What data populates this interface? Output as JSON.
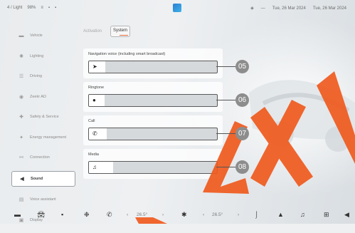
{
  "status_bar": {
    "left_items": [
      "4 / Light",
      "98%",
      "≡",
      "▪",
      "▪"
    ],
    "right_items": [
      "◈",
      "—",
      "Tue, 26 Mar 2024",
      "Tue, 26 Mar 2024"
    ]
  },
  "sidebar": {
    "items": [
      {
        "icon": "vehicle-icon",
        "glyph": "▬",
        "label": "Vehicle"
      },
      {
        "icon": "lighting-icon",
        "glyph": "✺",
        "label": "Lighting"
      },
      {
        "icon": "driving-icon",
        "glyph": "☰",
        "label": "Driving"
      },
      {
        "icon": "zeekr-ad-icon",
        "glyph": "◉",
        "label": "Zeekr AD"
      },
      {
        "icon": "safety-icon",
        "glyph": "✚",
        "label": "Safety & Service"
      },
      {
        "icon": "energy-icon",
        "glyph": "✦",
        "label": "Energy management"
      },
      {
        "icon": "connection-icon",
        "glyph": "⚯",
        "label": "Connection"
      },
      {
        "icon": "sound-icon",
        "glyph": "◀",
        "label": "Sound"
      },
      {
        "icon": "voice-assistant-icon",
        "glyph": "▤",
        "label": "Voice assistant"
      },
      {
        "icon": "display-icon",
        "glyph": "▣",
        "label": "Display"
      }
    ]
  },
  "tabs": [
    {
      "label": "Activation",
      "active": false
    },
    {
      "label": "System",
      "active": true
    }
  ],
  "volume_settings": [
    {
      "label": "Navigation voice (including smart broadcast)",
      "icon": "navigation-arrow-icon",
      "glyph": "➤",
      "level": 0.13,
      "callout": "05"
    },
    {
      "label": "Ringtone",
      "icon": "bell-icon",
      "glyph": "●",
      "level": 0.12,
      "callout": "06"
    },
    {
      "label": "Call",
      "icon": "phone-icon",
      "glyph": "✆",
      "level": 0.14,
      "callout": "07"
    },
    {
      "label": "Media",
      "icon": "music-note-icon",
      "glyph": "♫",
      "level": 0.19,
      "callout": "08"
    }
  ],
  "dock": {
    "left_temp": "26.5°",
    "right_temp": "26.5°"
  },
  "colors": {
    "accent": "#e26a3a",
    "callout": "#8d8d8d",
    "watermark": "#f05a1e"
  }
}
